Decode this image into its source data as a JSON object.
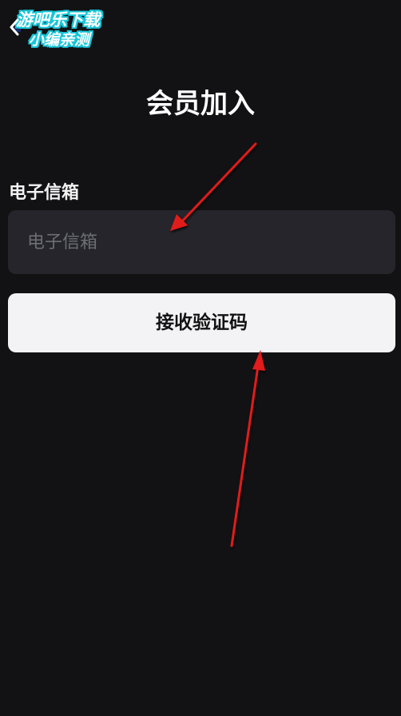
{
  "header": {
    "back_icon": "chevron-left-icon",
    "watermark": {
      "line1": "游吧乐下载",
      "line2": "小编亲测",
      "color": "#18c6d8"
    }
  },
  "main": {
    "title": "会员加入",
    "email_field": {
      "label": "电子信箱",
      "placeholder": "电子信箱",
      "value": ""
    },
    "submit_button": {
      "label": "接收验证码"
    }
  },
  "annotations": {
    "arrow_color": "#e01a1a",
    "arrow_count": 2
  }
}
